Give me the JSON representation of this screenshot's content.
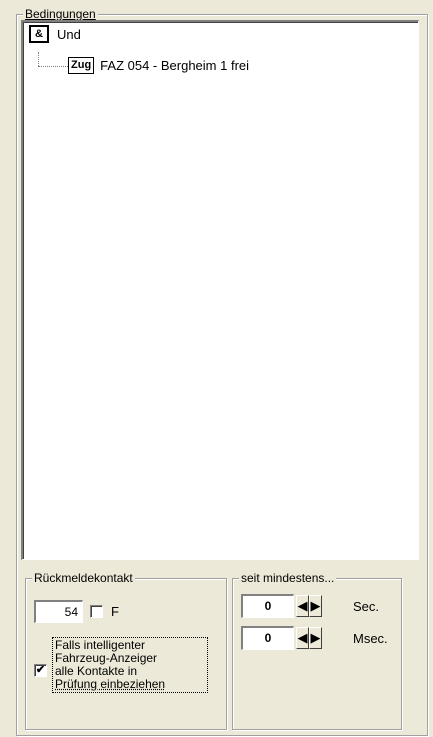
{
  "conditions": {
    "legend": "Bedingungen",
    "tree": [
      {
        "icon_text": "&",
        "label": "Und"
      },
      {
        "icon_text": "Zug",
        "label": "FAZ 054 - Bergheim 1 frei"
      }
    ]
  },
  "feedback": {
    "legend": "Rückmeldekontakt",
    "contact_value": "54",
    "f_checkbox_label": "F",
    "f_checked": false,
    "smart_checked": true,
    "smart_label_lines": [
      "Falls intelligenter",
      "Fahrzeug-Anzeiger",
      "alle Kontakte in",
      "Prüfung einbeziehen"
    ]
  },
  "since": {
    "legend": "seit mindestens...",
    "sec_value": "0",
    "sec_label": "Sec.",
    "msec_value": "0",
    "msec_label": "Msec."
  }
}
